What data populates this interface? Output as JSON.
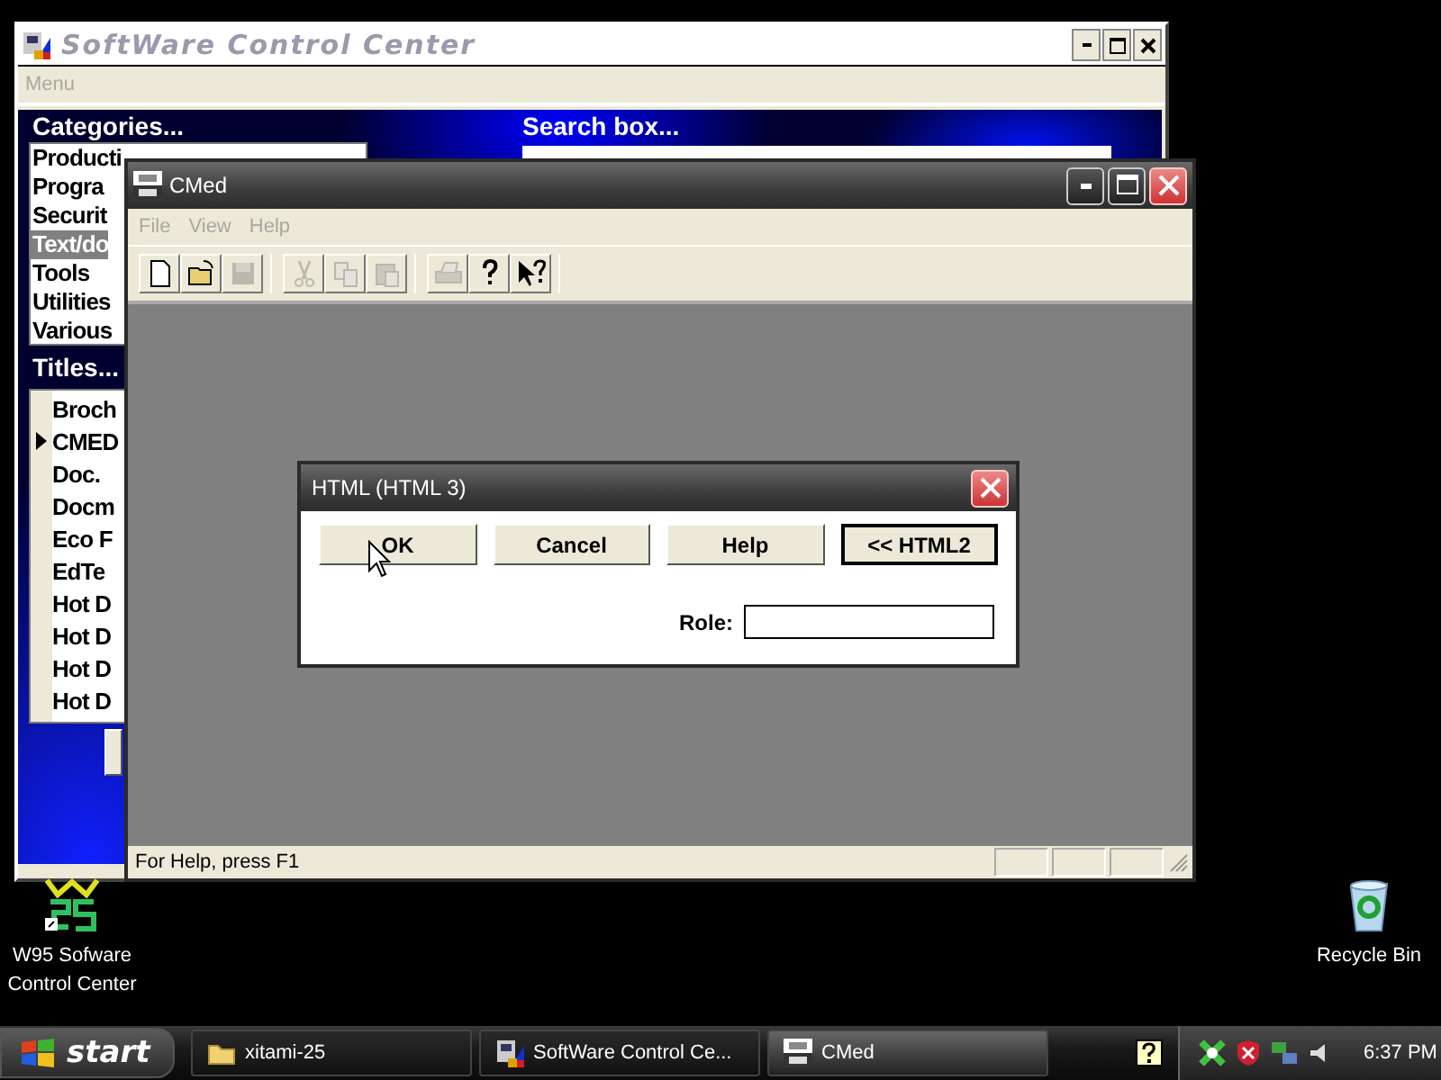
{
  "desktop_icons": [
    {
      "label": "W95 Sofware Control Center",
      "kind": "w95"
    },
    {
      "label": "Recycle Bin",
      "kind": "bin"
    }
  ],
  "scc_window": {
    "title": "SoftWare Control Center",
    "menu": [
      {
        "label": "Menu",
        "disabled": true
      }
    ],
    "categories_label": "Categories...",
    "categories": [
      {
        "label": "Producti",
        "selected": false
      },
      {
        "label": "Progra",
        "selected": false
      },
      {
        "label": "Securit",
        "selected": false
      },
      {
        "label": "Text/do",
        "selected": true
      },
      {
        "label": "Tools",
        "selected": false
      },
      {
        "label": "Utilities",
        "selected": false
      },
      {
        "label": "Various",
        "selected": false
      }
    ],
    "titles_label": "Titles...",
    "titles": [
      {
        "label": "Broch",
        "current": false
      },
      {
        "label": "CMED",
        "current": true
      },
      {
        "label": "Doc.",
        "current": false
      },
      {
        "label": "Docm",
        "current": false
      },
      {
        "label": "Eco F",
        "current": false
      },
      {
        "label": "EdTe",
        "current": false
      },
      {
        "label": "Hot D",
        "current": false
      },
      {
        "label": "Hot D",
        "current": false
      },
      {
        "label": "Hot D",
        "current": false
      },
      {
        "label": "Hot D",
        "current": false
      }
    ],
    "search_label": "Search box..."
  },
  "cmed_window": {
    "title": "CMed",
    "menu": [
      {
        "label": "File",
        "disabled": true
      },
      {
        "label": "View",
        "disabled": true
      },
      {
        "label": "Help",
        "disabled": true
      }
    ],
    "toolbar": [
      {
        "kind": "new",
        "disabled": false
      },
      {
        "kind": "open",
        "disabled": false
      },
      {
        "kind": "save",
        "disabled": true
      },
      {
        "kind": "sep"
      },
      {
        "kind": "cut",
        "disabled": true
      },
      {
        "kind": "copy",
        "disabled": true
      },
      {
        "kind": "paste",
        "disabled": true
      },
      {
        "kind": "sep"
      },
      {
        "kind": "print",
        "disabled": true
      },
      {
        "kind": "help",
        "disabled": false
      },
      {
        "kind": "context_help",
        "disabled": false
      }
    ],
    "status": "For Help, press F1"
  },
  "dialog": {
    "title": "HTML (HTML 3)",
    "buttons": [
      {
        "label": "OK",
        "default": false
      },
      {
        "label": "Cancel",
        "default": false
      },
      {
        "label": "Help",
        "default": false
      },
      {
        "label": "<< HTML2",
        "default": true
      }
    ],
    "role_label": "Role:"
  },
  "taskbar": {
    "start": "start",
    "tasks": [
      {
        "label": "xitami-25",
        "kind": "folder",
        "selected": false
      },
      {
        "label": "SoftWare Control Ce...",
        "kind": "scc",
        "selected": false
      },
      {
        "label": "CMed",
        "kind": "afx",
        "selected": true
      }
    ],
    "clock": "6:37 PM"
  }
}
